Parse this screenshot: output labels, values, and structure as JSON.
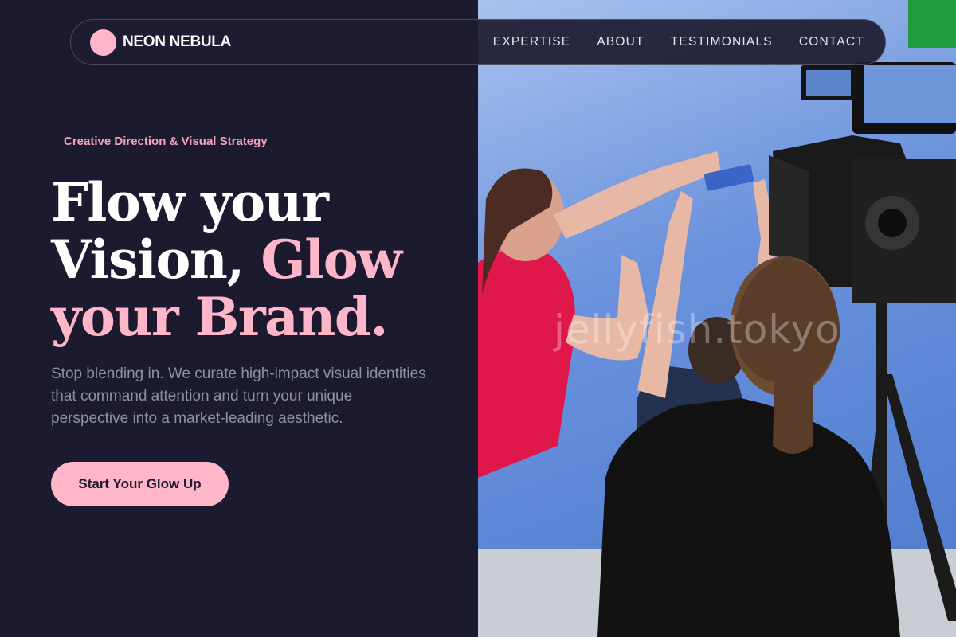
{
  "nav": {
    "brand": "NEON NEBULA",
    "links": [
      "EXPERTISE",
      "ABOUT",
      "TESTIMONIALS",
      "CONTACT"
    ]
  },
  "hero": {
    "eyebrow": "Creative Direction & Visual Strategy",
    "headline": {
      "line1": "Flow your",
      "line2_part1": "Vision, ",
      "line2_accent": "Glow",
      "line3_accent": "your Brand."
    },
    "description": "Stop blending in. We curate high-impact visual identities that command attention and turn your unique perspective into a market-leading aesthetic.",
    "cta_label": "Start Your Glow Up"
  },
  "image": {
    "watermark": "jellyfish.tokyo"
  },
  "colors": {
    "background": "#1c1a2e",
    "accent_pink": "#ffb6c8",
    "eyebrow_pink": "#f7a3bb",
    "muted_text": "#8e91a8",
    "backdrop_blue": "#5b86d6"
  }
}
